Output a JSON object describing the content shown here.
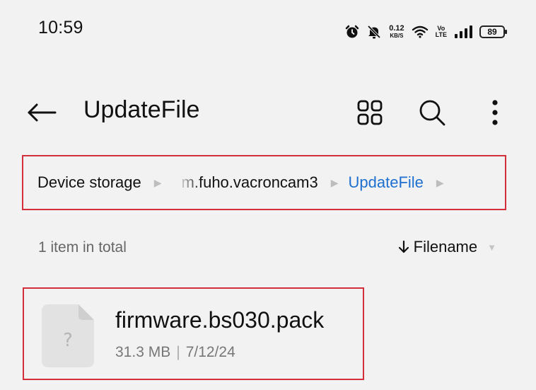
{
  "status_bar": {
    "time": "10:59",
    "icons": [
      "alarm-icon",
      "mute-icon",
      "netspeed-icon",
      "wifi-icon",
      "volte-icon",
      "signal-icon",
      "battery-icon"
    ],
    "net_speed_value": "0.12",
    "net_speed_unit": "KB/S",
    "volte_top": "Vo",
    "volte_bottom": "LTE",
    "battery": "89"
  },
  "app_bar": {
    "title": "UpdateFile",
    "icons": [
      "back-arrow-icon",
      "grid-view-icon",
      "search-icon",
      "more-vert-icon"
    ]
  },
  "breadcrumb": {
    "items": [
      "Device storage",
      "m.fuho.vacroncam3",
      "UpdateFile"
    ],
    "separator_icon": "chevron-right-icon"
  },
  "list": {
    "count_text": "1 item in total",
    "sort_label": "Filename",
    "sort_icons": [
      "sort-down-arrow-icon",
      "dropdown-triangle-icon"
    ]
  },
  "files": [
    {
      "name": "firmware.bs030.pack",
      "size": "31.3 MB",
      "date": "7/12/24",
      "separator": "|",
      "icon": "unknown-file-icon"
    }
  ],
  "colors": {
    "background": "#f2f2f2",
    "accent": "#1e6fd0",
    "highlight_border": "#d32f3a",
    "secondary_text": "#666666"
  }
}
